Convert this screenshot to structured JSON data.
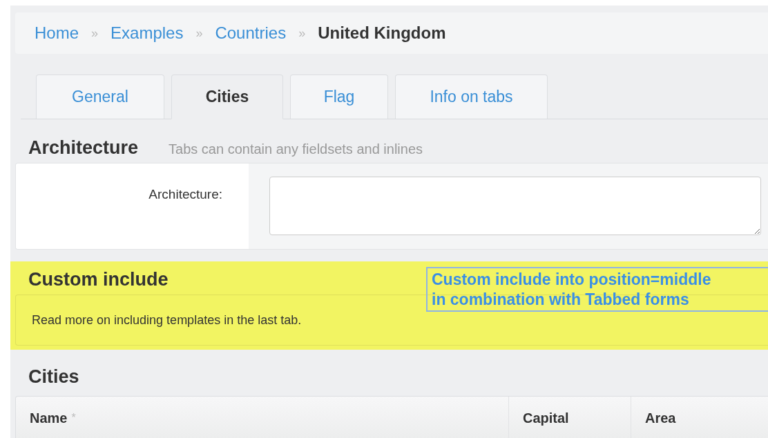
{
  "breadcrumbs": [
    {
      "label": "Home",
      "kind": "link"
    },
    {
      "label": "Examples",
      "kind": "link"
    },
    {
      "label": "Countries",
      "kind": "link"
    },
    {
      "label": "United Kingdom",
      "kind": "current"
    }
  ],
  "breadcrumb_separator": "»",
  "tabs": [
    {
      "label": "General",
      "selected": false
    },
    {
      "label": "Cities",
      "selected": true
    },
    {
      "label": "Flag",
      "selected": false
    },
    {
      "label": "Info on tabs",
      "selected": false
    }
  ],
  "architecture": {
    "title": "Architecture",
    "description": "Tabs can contain any fieldsets and inlines",
    "field_label": "Architecture:"
  },
  "custom_include": {
    "title": "Custom include",
    "text": "Read more on including templates in the last tab.",
    "highlighted": true,
    "annotation": [
      "Custom include into position=middle",
      "in combination with Tabbed forms"
    ]
  },
  "cities": {
    "title": "Cities",
    "columns": [
      {
        "label": "Name",
        "required_mark": "*"
      },
      {
        "label": "Capital"
      },
      {
        "label": "Area"
      }
    ]
  }
}
